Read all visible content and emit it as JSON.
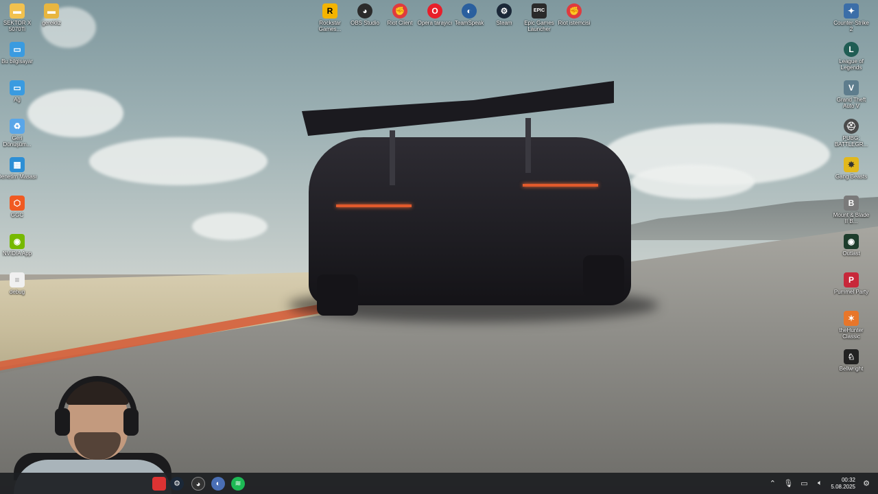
{
  "desktop": {
    "left_icons": [
      {
        "label": "SEKTOR X 5070Ti",
        "icon": "folder-icon",
        "color": "#f2c14e"
      },
      {
        "label": "gerekliz",
        "icon": "folder-icon",
        "color": "#e8b640"
      },
      {
        "label": "Bu bilgisayar",
        "icon": "computer-icon",
        "color": "#3a9be0"
      },
      {
        "label": "Ağ",
        "icon": "network-icon",
        "color": "#3a9be0"
      },
      {
        "label": "Geri Dönüşüm...",
        "icon": "recycle-bin-icon",
        "color": "#5aa6e8"
      },
      {
        "label": "Denetim Masası",
        "icon": "control-panel-icon",
        "color": "#2d8fd5"
      },
      {
        "label": "GGC",
        "icon": "ggc-icon",
        "color": "#f05a22"
      },
      {
        "label": "NVIDIA App",
        "icon": "nvidia-icon",
        "color": "#76b900"
      },
      {
        "label": "debug",
        "icon": "file-icon",
        "color": "#f0f0f0"
      }
    ],
    "top_icons": [
      {
        "label": "Rockstar Games...",
        "icon": "rockstar-icon",
        "color": "#f4b400"
      },
      {
        "label": "OBS Studio",
        "icon": "obs-icon",
        "color": "#2b2b2b"
      },
      {
        "label": "Riot Client",
        "icon": "riot-icon",
        "color": "#e03a3e"
      },
      {
        "label": "Opera tarayıcı",
        "icon": "opera-icon",
        "color": "#e81e2a"
      },
      {
        "label": "TeamSpeak",
        "icon": "teamspeak-icon",
        "color": "#2a5f9e"
      },
      {
        "label": "Steam",
        "icon": "steam-icon",
        "color": "#1b2838"
      },
      {
        "label": "Epic Games Launcher",
        "icon": "epic-icon",
        "color": "#2a2a2a"
      },
      {
        "label": "Riot istemcisi",
        "icon": "riot-icon",
        "color": "#e03a3e"
      }
    ],
    "right_icons": [
      {
        "label": "Counter-Strike 2",
        "icon": "cs2-icon",
        "color": "#3b6ea8"
      },
      {
        "label": "League of Legends",
        "icon": "lol-icon",
        "color": "#1f5d54"
      },
      {
        "label": "Grand Theft Auto V",
        "icon": "gta-icon",
        "color": "#5e7d8d"
      },
      {
        "label": "PUBG: BATTLEGR...",
        "icon": "pubg-icon",
        "color": "#4a4a4a"
      },
      {
        "label": "Gang Beasts",
        "icon": "gang-beasts-icon",
        "color": "#e2b81c"
      },
      {
        "label": "Mount & Blade II B...",
        "icon": "bannerlord-icon",
        "color": "#7a7a7a"
      },
      {
        "label": "Outlast",
        "icon": "outlast-icon",
        "color": "#1e3d2c"
      },
      {
        "label": "Pummel Party",
        "icon": "pummel-party-icon",
        "color": "#c8283a"
      },
      {
        "label": "theHunter Classic",
        "icon": "thehunter-icon",
        "color": "#e8762a"
      },
      {
        "label": "Bellwright",
        "icon": "bellwright-icon",
        "color": "#222222"
      }
    ]
  },
  "taskbar": {
    "apps": [
      {
        "icon": "app-icon-red",
        "color": "#d33"
      },
      {
        "icon": "steam-taskbar-icon",
        "color": "#1b2838"
      },
      {
        "icon": "obs-taskbar-icon",
        "color": "#333"
      },
      {
        "icon": "app-icon-blue",
        "color": "#4a6fb5"
      },
      {
        "icon": "spotify-icon",
        "color": "#1db954"
      }
    ],
    "tray": {
      "time": "00:32",
      "date": "5.08.2025"
    }
  }
}
